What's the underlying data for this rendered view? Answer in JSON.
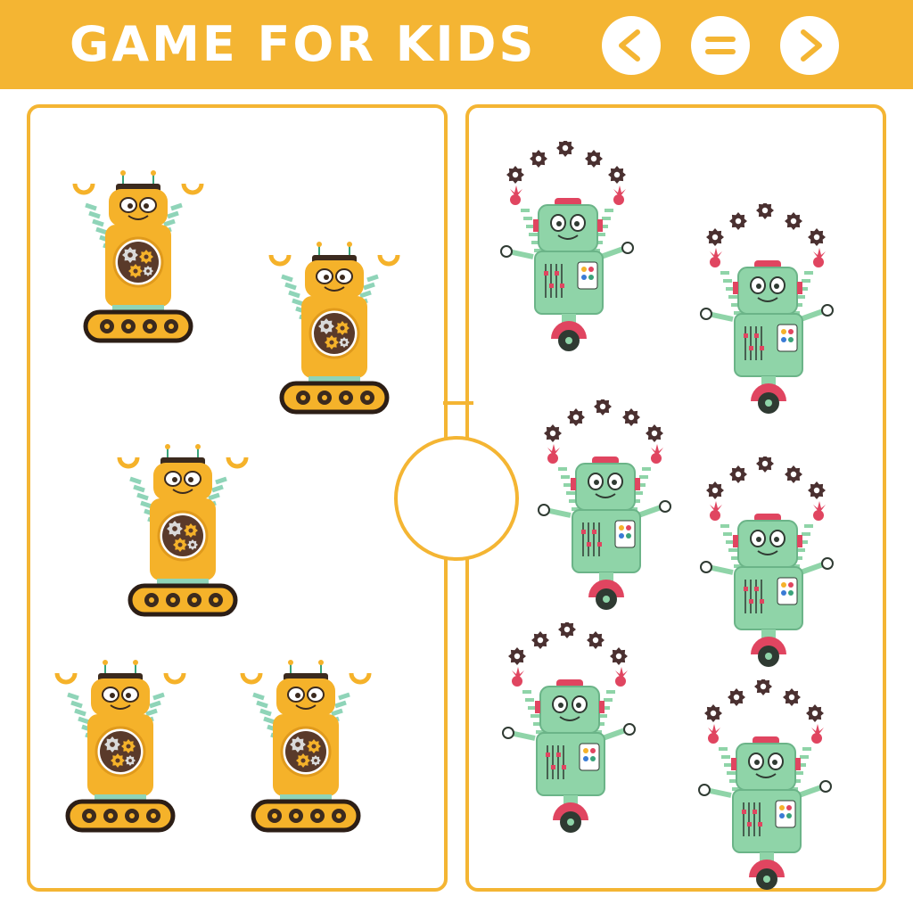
{
  "header": {
    "title": "GAME FOR KIDS",
    "background_color": "#f4b533",
    "buttons": [
      {
        "name": "previous",
        "icon": "chevron-left-icon"
      },
      {
        "name": "equals",
        "icon": "equals-icon"
      },
      {
        "name": "next",
        "icon": "chevron-right-icon"
      }
    ]
  },
  "left_panel": {
    "robot_type": "yellow-tracked-robot",
    "robot_count": 5
  },
  "right_panel": {
    "robot_type": "green-juggling-robot",
    "robot_count": 6
  },
  "answer_slot": {
    "shape": "circle",
    "value": ""
  },
  "colors": {
    "accent": "#f4b533",
    "yellow_robot": "#f5b22a",
    "green_robot": "#8fd4a8",
    "gear": "#4a3030",
    "arm_stripes": "#8fd4b8"
  }
}
